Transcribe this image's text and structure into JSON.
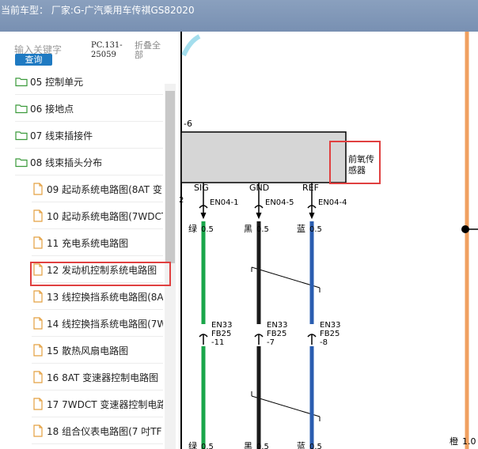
{
  "header": {
    "title": "当前车型：  厂家:G-广汽乘用车传祺GS82020"
  },
  "search": {
    "placeholder": "输入关键字",
    "button_label": "查询",
    "code": "PC.131-25059",
    "collapse_label": "折叠全部"
  },
  "tree": [
    {
      "label": "05 控制单元",
      "type": "folder"
    },
    {
      "label": "06 接地点",
      "type": "folder"
    },
    {
      "label": "07 线束插接件",
      "type": "folder"
    },
    {
      "label": "08 线束插头分布",
      "type": "folder"
    },
    {
      "label": "09 起动系统电路图(8AT 变",
      "type": "file"
    },
    {
      "label": "10 起动系统电路图(7WDCT",
      "type": "file"
    },
    {
      "label": "11 充电系统电路图",
      "type": "file"
    },
    {
      "label": "12 发动机控制系统电路图",
      "type": "file",
      "selected": true
    },
    {
      "label": "13 线控换挡系统电路图(8A",
      "type": "file"
    },
    {
      "label": "14 线控换挡系统电路图(7W",
      "type": "file"
    },
    {
      "label": "15 散热风扇电路图",
      "type": "file"
    },
    {
      "label": "16 8AT 变速器控制电路图",
      "type": "file"
    },
    {
      "label": "17 7WDCT 变速器控制电路",
      "type": "file"
    },
    {
      "label": "18 组合仪表电路图(7 吋TF",
      "type": "file"
    }
  ],
  "diagram": {
    "left_label": "-6",
    "component_name": "前氧传感器",
    "pins": [
      {
        "name": "SIG",
        "connector": "EN04-1",
        "color_label": "绿",
        "gauge": "0.5",
        "wire_color": "#1aa64a",
        "inline_connector": "EN33",
        "inline_pin_a": "FB25",
        "inline_pin_b": "-11",
        "bottom_color_label": "绿",
        "bottom_gauge": "0.5"
      },
      {
        "name": "GND",
        "connector": "EN04-5",
        "color_label": "黑",
        "gauge": "0.5",
        "wire_color": "#1a1a1a",
        "inline_connector": "EN33",
        "inline_pin_a": "FB25",
        "inline_pin_b": "-7",
        "bottom_color_label": "黑",
        "bottom_gauge": "0.5"
      },
      {
        "name": "REF",
        "connector": "EN04-4",
        "color_label": "蓝",
        "gauge": "0.5",
        "wire_color": "#2a5db0",
        "inline_connector": "EN33",
        "inline_pin_a": "FB25",
        "inline_pin_b": "-8",
        "bottom_color_label": "蓝",
        "bottom_gauge": "0.5"
      }
    ],
    "right_wire_color_label": "橙",
    "right_wire_gauge": "1.0",
    "right_wire_color": "#f0a060",
    "left_pin_marker": "2"
  },
  "colors": {
    "titlebar": "#7f96b8",
    "accent": "#1f7ac2",
    "highlight": "#e04040"
  }
}
